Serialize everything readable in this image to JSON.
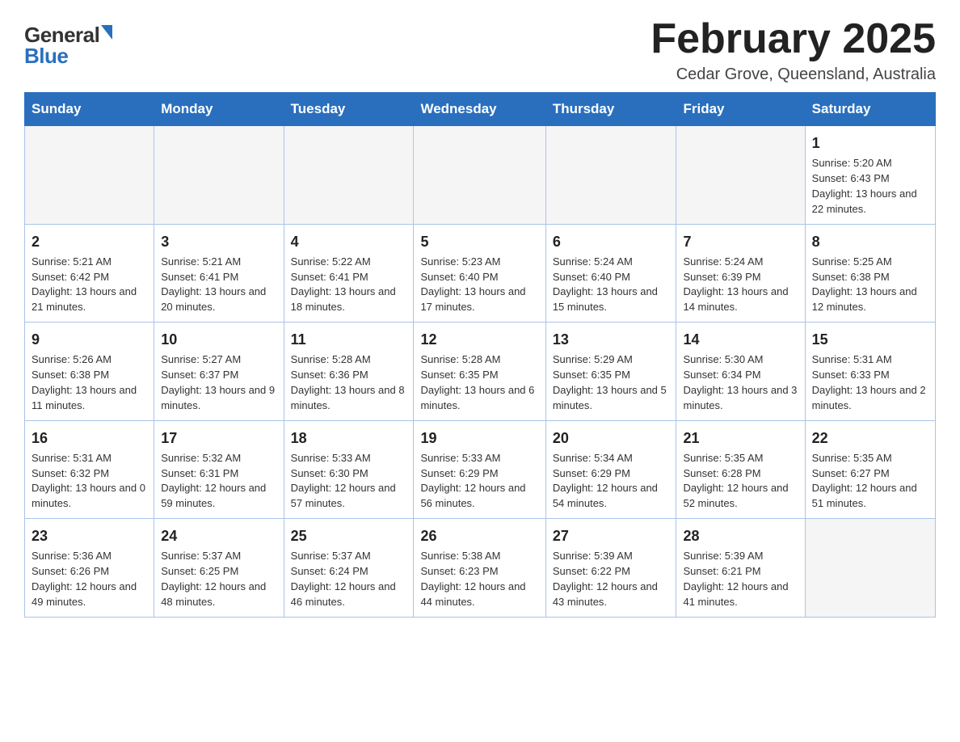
{
  "logo": {
    "general": "General",
    "blue": "Blue"
  },
  "title": "February 2025",
  "location": "Cedar Grove, Queensland, Australia",
  "days_of_week": [
    "Sunday",
    "Monday",
    "Tuesday",
    "Wednesday",
    "Thursday",
    "Friday",
    "Saturday"
  ],
  "weeks": [
    [
      {
        "day": "",
        "info": ""
      },
      {
        "day": "",
        "info": ""
      },
      {
        "day": "",
        "info": ""
      },
      {
        "day": "",
        "info": ""
      },
      {
        "day": "",
        "info": ""
      },
      {
        "day": "",
        "info": ""
      },
      {
        "day": "1",
        "info": "Sunrise: 5:20 AM\nSunset: 6:43 PM\nDaylight: 13 hours and 22 minutes."
      }
    ],
    [
      {
        "day": "2",
        "info": "Sunrise: 5:21 AM\nSunset: 6:42 PM\nDaylight: 13 hours and 21 minutes."
      },
      {
        "day": "3",
        "info": "Sunrise: 5:21 AM\nSunset: 6:41 PM\nDaylight: 13 hours and 20 minutes."
      },
      {
        "day": "4",
        "info": "Sunrise: 5:22 AM\nSunset: 6:41 PM\nDaylight: 13 hours and 18 minutes."
      },
      {
        "day": "5",
        "info": "Sunrise: 5:23 AM\nSunset: 6:40 PM\nDaylight: 13 hours and 17 minutes."
      },
      {
        "day": "6",
        "info": "Sunrise: 5:24 AM\nSunset: 6:40 PM\nDaylight: 13 hours and 15 minutes."
      },
      {
        "day": "7",
        "info": "Sunrise: 5:24 AM\nSunset: 6:39 PM\nDaylight: 13 hours and 14 minutes."
      },
      {
        "day": "8",
        "info": "Sunrise: 5:25 AM\nSunset: 6:38 PM\nDaylight: 13 hours and 12 minutes."
      }
    ],
    [
      {
        "day": "9",
        "info": "Sunrise: 5:26 AM\nSunset: 6:38 PM\nDaylight: 13 hours and 11 minutes."
      },
      {
        "day": "10",
        "info": "Sunrise: 5:27 AM\nSunset: 6:37 PM\nDaylight: 13 hours and 9 minutes."
      },
      {
        "day": "11",
        "info": "Sunrise: 5:28 AM\nSunset: 6:36 PM\nDaylight: 13 hours and 8 minutes."
      },
      {
        "day": "12",
        "info": "Sunrise: 5:28 AM\nSunset: 6:35 PM\nDaylight: 13 hours and 6 minutes."
      },
      {
        "day": "13",
        "info": "Sunrise: 5:29 AM\nSunset: 6:35 PM\nDaylight: 13 hours and 5 minutes."
      },
      {
        "day": "14",
        "info": "Sunrise: 5:30 AM\nSunset: 6:34 PM\nDaylight: 13 hours and 3 minutes."
      },
      {
        "day": "15",
        "info": "Sunrise: 5:31 AM\nSunset: 6:33 PM\nDaylight: 13 hours and 2 minutes."
      }
    ],
    [
      {
        "day": "16",
        "info": "Sunrise: 5:31 AM\nSunset: 6:32 PM\nDaylight: 13 hours and 0 minutes."
      },
      {
        "day": "17",
        "info": "Sunrise: 5:32 AM\nSunset: 6:31 PM\nDaylight: 12 hours and 59 minutes."
      },
      {
        "day": "18",
        "info": "Sunrise: 5:33 AM\nSunset: 6:30 PM\nDaylight: 12 hours and 57 minutes."
      },
      {
        "day": "19",
        "info": "Sunrise: 5:33 AM\nSunset: 6:29 PM\nDaylight: 12 hours and 56 minutes."
      },
      {
        "day": "20",
        "info": "Sunrise: 5:34 AM\nSunset: 6:29 PM\nDaylight: 12 hours and 54 minutes."
      },
      {
        "day": "21",
        "info": "Sunrise: 5:35 AM\nSunset: 6:28 PM\nDaylight: 12 hours and 52 minutes."
      },
      {
        "day": "22",
        "info": "Sunrise: 5:35 AM\nSunset: 6:27 PM\nDaylight: 12 hours and 51 minutes."
      }
    ],
    [
      {
        "day": "23",
        "info": "Sunrise: 5:36 AM\nSunset: 6:26 PM\nDaylight: 12 hours and 49 minutes."
      },
      {
        "day": "24",
        "info": "Sunrise: 5:37 AM\nSunset: 6:25 PM\nDaylight: 12 hours and 48 minutes."
      },
      {
        "day": "25",
        "info": "Sunrise: 5:37 AM\nSunset: 6:24 PM\nDaylight: 12 hours and 46 minutes."
      },
      {
        "day": "26",
        "info": "Sunrise: 5:38 AM\nSunset: 6:23 PM\nDaylight: 12 hours and 44 minutes."
      },
      {
        "day": "27",
        "info": "Sunrise: 5:39 AM\nSunset: 6:22 PM\nDaylight: 12 hours and 43 minutes."
      },
      {
        "day": "28",
        "info": "Sunrise: 5:39 AM\nSunset: 6:21 PM\nDaylight: 12 hours and 41 minutes."
      },
      {
        "day": "",
        "info": ""
      }
    ]
  ]
}
